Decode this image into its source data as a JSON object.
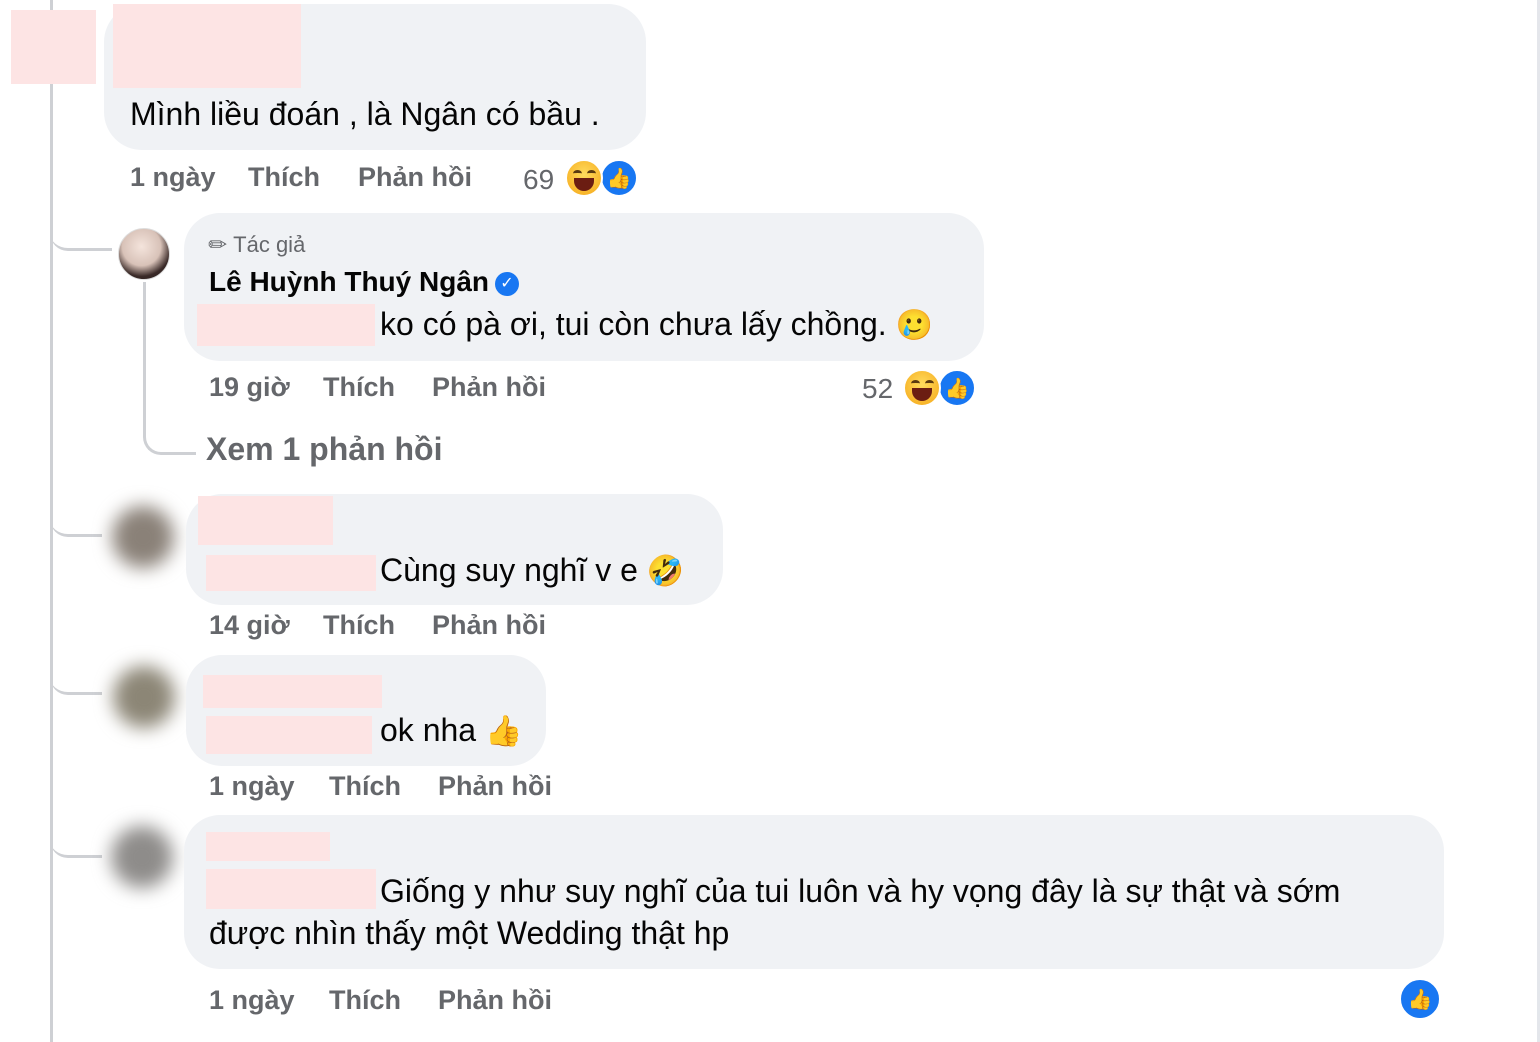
{
  "comments": [
    {
      "text": "Mình liều đoán , là Ngân có bầu .",
      "time": "1 ngày",
      "like": "Thích",
      "reply": "Phản hồi",
      "reaction_count": "69"
    },
    {
      "author_badge": "Tác giả",
      "author_name": "Lê Huỳnh Thuý Ngân",
      "text": "ko có pà ơi, tui còn chưa lấy chồng.",
      "emoji": "🥲",
      "time": "19 giờ",
      "like": "Thích",
      "reply": "Phản hồi",
      "reaction_count": "52"
    },
    {
      "text": "Cùng suy nghĩ v e",
      "emoji": "🤣",
      "time": "14 giờ",
      "like": "Thích",
      "reply": "Phản hồi"
    },
    {
      "text": "ok nha",
      "emoji": "👍",
      "time": "1 ngày",
      "like": "Thích",
      "reply": "Phản hồi"
    },
    {
      "text_line1": "Giống y như suy nghĩ của tui luôn và hy vọng đây là sự thật và sớm",
      "text_line2": "được nhìn thấy một Wedding thật hp",
      "time": "1 ngày",
      "like": "Thích",
      "reply": "Phản hồi"
    }
  ],
  "view_replies": "Xem 1 phản hồi",
  "icons": {
    "author": "pencil-icon",
    "verified": "verified-badge-icon",
    "reaction_haha": "haha-reaction-icon",
    "reaction_like": "like-reaction-icon"
  },
  "colors": {
    "bubble": "#f0f2f5",
    "meta_text": "#65676b",
    "like_blue": "#1877f2",
    "redaction": "#fde4e4"
  }
}
